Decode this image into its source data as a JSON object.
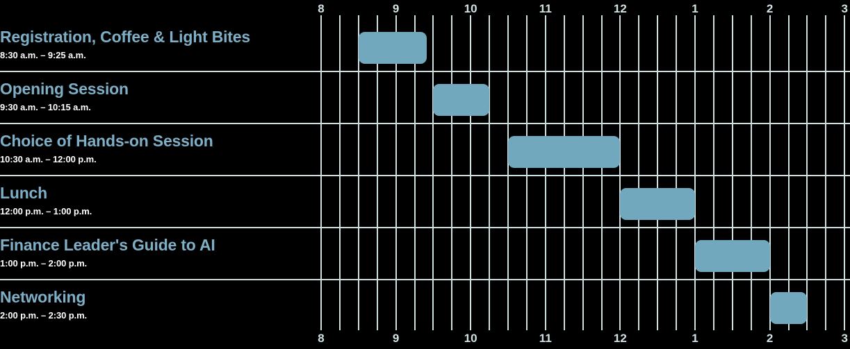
{
  "chart_data": {
    "type": "bar",
    "subtype": "gantt-timeline",
    "title": "",
    "xlabel": "",
    "ylabel": "",
    "grid": true,
    "legend": false,
    "axis": {
      "position": "both-top-and-bottom",
      "hour_labels": [
        "8",
        "9",
        "10",
        "11",
        "12",
        "1",
        "2",
        "3"
      ],
      "hour_values_24h": [
        8,
        9,
        10,
        11,
        12,
        13,
        14,
        15
      ],
      "xlim_label": [
        "8:00 a.m.",
        "3:00 p.m."
      ],
      "minor_tick_interval_minutes": 15
    },
    "categories": [
      "Registration, Coffee & Light Bites",
      "Opening Session",
      "Choice of Hands-on Session",
      "Lunch",
      "Finance Leader's Guide to AI",
      "Networking"
    ],
    "bars": [
      {
        "label": "Registration, Coffee & Light Bites",
        "time_range": "8:30 a.m. – 9:25 a.m.",
        "start_hour": 8.5,
        "end_hour": 9.4167,
        "duration_minutes": 55
      },
      {
        "label": "Opening Session",
        "time_range": "9:30 a.m. – 10:15 a.m.",
        "start_hour": 9.5,
        "end_hour": 10.25,
        "duration_minutes": 45
      },
      {
        "label": "Choice of Hands-on Session",
        "time_range": "10:30 a.m. – 12:00 p.m.",
        "start_hour": 10.5,
        "end_hour": 12.0,
        "duration_minutes": 90
      },
      {
        "label": "Lunch",
        "time_range": "12:00 p.m. – 1:00 p.m.",
        "start_hour": 12.0,
        "end_hour": 13.0,
        "duration_minutes": 60
      },
      {
        "label": "Finance Leader's Guide to AI",
        "time_range": "1:00 p.m. – 2:00 p.m.",
        "start_hour": 13.0,
        "end_hour": 14.0,
        "duration_minutes": 60
      },
      {
        "label": "Networking",
        "time_range": "2:00 p.m. – 2:30 p.m.",
        "start_hour": 14.0,
        "end_hour": 14.5,
        "duration_minutes": 30
      }
    ],
    "colors": {
      "background": "#000000",
      "bar": "#71a8bd",
      "grid": "#cfe0e0",
      "title_text": "#7fafc6",
      "time_text": "#ffffff",
      "axis_text": "#cfe1e2"
    }
  }
}
